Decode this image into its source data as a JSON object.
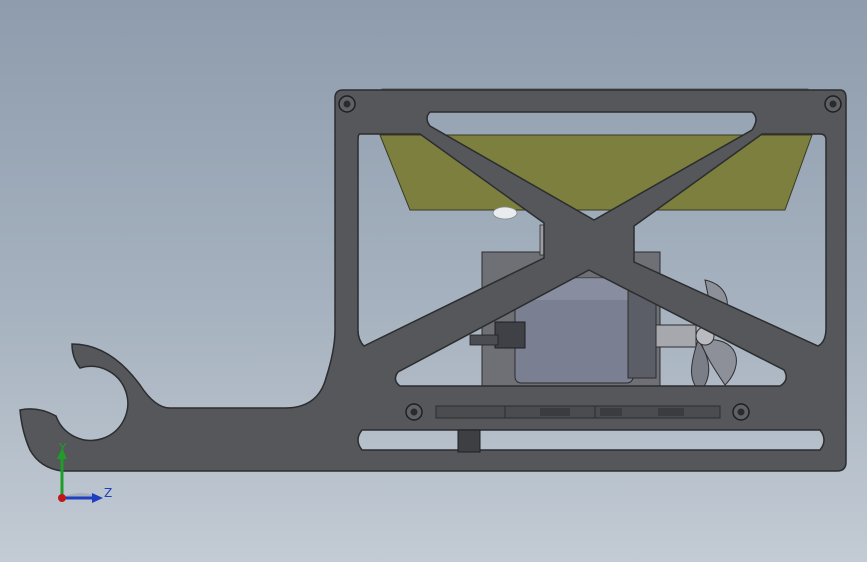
{
  "viewport": {
    "background_top": "#8e9cad",
    "background_bottom": "#c3cbd4"
  },
  "model": {
    "frame_color": "#55575a",
    "frame_edge": "#2c2d2f",
    "panel_color": "#7d7f3e",
    "motor_color": "#7a7f92",
    "fan_color": "#8d9099"
  },
  "triad": {
    "y_label": "Y",
    "z_label": "Z",
    "y_color": "#1f9d2a",
    "z_color": "#1e3fbf",
    "x_color": "#c0161a"
  }
}
